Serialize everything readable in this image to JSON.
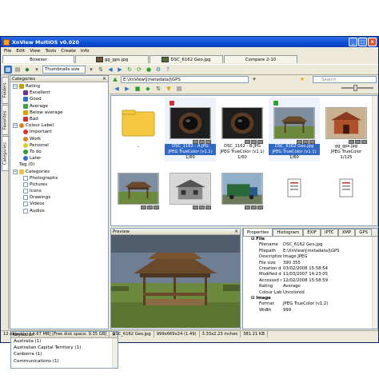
{
  "window": {
    "title": "XnView MultiOS v0.020",
    "min": "_",
    "max": "□",
    "close": "x"
  },
  "menu": [
    "File",
    "Edit",
    "View",
    "Tools",
    "Create",
    "Info"
  ],
  "tabs": [
    "Browser",
    "gg_gps.jpg",
    "DSC_6162 Geo.jpg",
    "Compare 2-10"
  ],
  "toolbar": {
    "thumb_size_label": "Thumbnails size"
  },
  "sidetabs": [
    "Folders",
    "Favorites",
    "Categories"
  ],
  "categories": {
    "header": "Categories",
    "rating_label": "Rating",
    "rating_items": [
      {
        "label": "Excellent",
        "color": "#7030a0"
      },
      {
        "label": "Good",
        "color": "#3070d0"
      },
      {
        "label": "Average",
        "color": "#40a040"
      },
      {
        "label": "Below average",
        "color": "#e0a000"
      },
      {
        "label": "Bad",
        "color": "#d03030"
      }
    ],
    "colour_label": "Colour Label",
    "colour_items": [
      {
        "label": "Important",
        "color": "#e03030"
      },
      {
        "label": "Work",
        "color": "#e08020"
      },
      {
        "label": "Personal",
        "color": "#e0d020"
      },
      {
        "label": "To do",
        "color": "#30a030"
      },
      {
        "label": "Later",
        "color": "#3070d0"
      }
    ],
    "tag_label": "Tag (0)",
    "categories_label": "Categories",
    "category_items": [
      "Photographs",
      "Pictures",
      "Icons",
      "Drawings",
      "Videos",
      "Audios"
    ]
  },
  "keywords": {
    "header": "Keywords",
    "items": [
      "Australia (1)",
      "Australian Capital Territory (1)",
      "Canberra (1)",
      "Communications (1)"
    ]
  },
  "address": {
    "path": "E:\\XnView\\[metadata]\\GPS",
    "search_placeholder": "Search"
  },
  "thumbnails": [
    {
      "caption": "..",
      "type": "folder",
      "badge": "",
      "format": "",
      "size": "",
      "selected": false
    },
    {
      "caption": "DSC_1162 - A.JPG",
      "type": "camera",
      "badge": "#d03030",
      "format": "JPEG TrueColor (v1.1)",
      "size": "1/60",
      "selected": true
    },
    {
      "caption": "DSC_1162 - B.JPG",
      "type": "camera",
      "badge": "",
      "format": "JPEG TrueColor (v1.1)",
      "size": "1/60",
      "selected": false
    },
    {
      "caption": "DSC_6162 Geo.jpg",
      "type": "gazebo",
      "badge": "#30a030",
      "format": "JPEG TrueColor (v1.1)",
      "size": "1/60",
      "selected": true
    },
    {
      "caption": "gg_gps.jpg",
      "type": "temple",
      "badge": "",
      "format": "JPEG TrueColor",
      "size": "1/125",
      "selected": false
    },
    {
      "caption": "",
      "type": "gazebo",
      "badge": "",
      "format": "",
      "size": "",
      "selected": false
    },
    {
      "caption": "",
      "type": "house",
      "badge": "",
      "format": "",
      "size": "",
      "selected": false
    },
    {
      "caption": "",
      "type": "truck",
      "badge": "",
      "format": "",
      "size": "",
      "selected": false
    },
    {
      "caption": "",
      "type": "doc",
      "badge": "",
      "format": "",
      "size": "",
      "selected": false
    },
    {
      "caption": "",
      "type": "doc",
      "badge": "",
      "format": "",
      "size": "",
      "selected": false
    }
  ],
  "preview": {
    "header": "Preview"
  },
  "properties": {
    "tabs": [
      "Properties",
      "Histogram",
      "EXIF",
      "IPTC",
      "XMP",
      "GPS"
    ],
    "groups": [
      {
        "name": "File",
        "rows": [
          [
            "Filename",
            "DSC_6162 Geo.jpg"
          ],
          [
            "Filepath",
            "E:\\XnView\\[metadata]\\GPS"
          ],
          [
            "Description",
            "Image JPEG"
          ],
          [
            "File size",
            "390 355"
          ],
          [
            "Creation date/time",
            "03/02/2008 15:58:54"
          ],
          [
            "Modified date/time",
            "11/03/2007 14:23:05"
          ],
          [
            "Accessed date/time",
            "12/02/2008 15:58:59"
          ],
          [
            "Rating",
            "Average"
          ],
          [
            "Colour Label",
            "Uncolored"
          ]
        ]
      },
      {
        "name": "Image",
        "rows": [
          [
            "Format",
            "JPEG TrueColor (v1.2)"
          ],
          [
            "Width",
            "999"
          ]
        ]
      }
    ]
  },
  "status": {
    "objects": "12 object(s) [ 4.67 MB] [Free disk space: 9.35 GB]",
    "file": "DSC_6162 Geo.jpg",
    "dims": "999x669x24 (1.49)",
    "inches": "3.33x2.23 inches",
    "size": "381.21 KB"
  }
}
